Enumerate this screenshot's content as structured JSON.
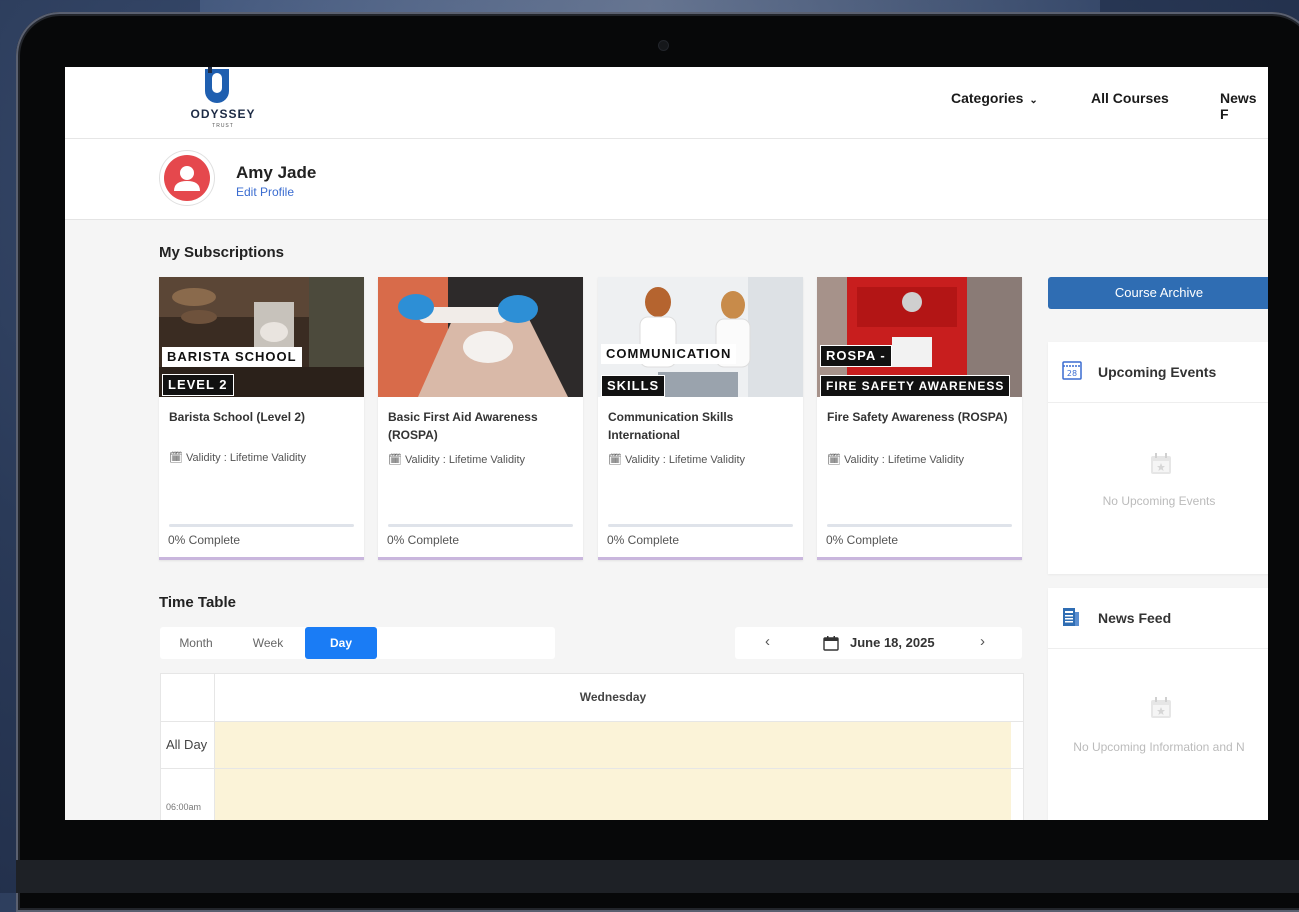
{
  "brand": {
    "name": "ODYSSEY",
    "sub": "TRUST"
  },
  "nav": {
    "categories": "Categories",
    "all_courses": "All Courses",
    "news_feed": "News F"
  },
  "profile": {
    "name": "Amy Jade",
    "edit_label": "Edit Profile"
  },
  "subscriptions": {
    "title": "My Subscriptions",
    "courses": [
      {
        "image_lines": [
          "BARISTA SCHOOL",
          "LEVEL 2"
        ],
        "title": "Barista School (Level 2)",
        "validity": "Validity : Lifetime Validity",
        "progress_text": "0% Complete",
        "progress": 0
      },
      {
        "image_lines": [],
        "title": "Basic First Aid Awareness (ROSPA)",
        "validity": "Validity : Lifetime Validity",
        "progress_text": "0% Complete",
        "progress": 0
      },
      {
        "image_lines": [
          "COMMUNICATION",
          "SKILLS"
        ],
        "title": "Communication Skills International",
        "validity": "Validity : Lifetime Validity",
        "progress_text": "0% Complete",
        "progress": 0
      },
      {
        "image_lines": [
          "ROSPA -",
          "FIRE SAFETY AWARENESS"
        ],
        "title": "Fire Safety Awareness (ROSPA)",
        "validity": "Validity : Lifetime Validity",
        "progress_text": "0% Complete",
        "progress": 0
      }
    ]
  },
  "sidebar": {
    "archive_button": "Course Archive",
    "events": {
      "title": "Upcoming Events",
      "icon_text": "28",
      "empty": "No Upcoming Events"
    },
    "news": {
      "title": "News Feed",
      "empty": "No Upcoming Information and N"
    }
  },
  "timetable": {
    "title": "Time Table",
    "views": [
      "Month",
      "Week",
      "Day"
    ],
    "active_view": "Day",
    "date": "June 18, 2025",
    "day_header": "Wednesday",
    "all_day_label": "All Day",
    "first_slot": "06:00am"
  },
  "colors": {
    "primary": "#2f6db3",
    "active": "#1a7cf5",
    "avatar": "#e5484d",
    "slot": "#fbf3d8"
  }
}
